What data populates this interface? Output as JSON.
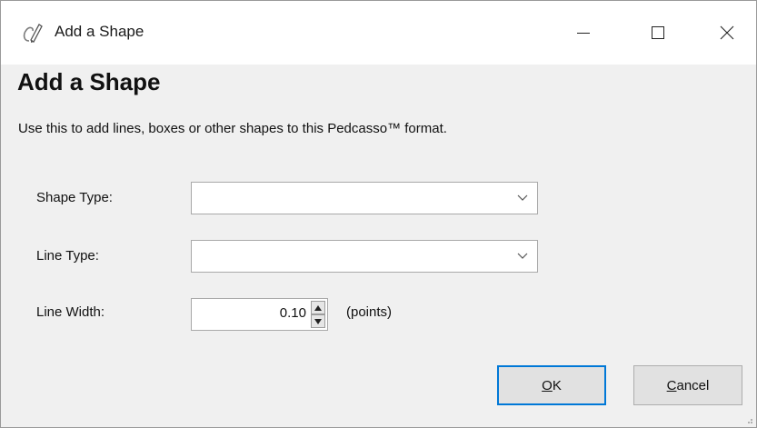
{
  "window": {
    "title": "Add a Shape",
    "icon": "pencil-app-icon",
    "controls": {
      "minimize": "minimize-icon",
      "maximize": "maximize-icon",
      "close": "close-icon"
    }
  },
  "dialog": {
    "heading": "Add a Shape",
    "description": "Use this to add lines, boxes or other shapes to this Pedcasso™ format."
  },
  "form": {
    "shape_type": {
      "label": "Shape Type:",
      "value": ""
    },
    "line_type": {
      "label": "Line Type:",
      "value": ""
    },
    "line_width": {
      "label": "Line Width:",
      "value": "0.10",
      "units": "(points)"
    }
  },
  "buttons": {
    "ok": {
      "mnemonic": "O",
      "rest": "K"
    },
    "cancel": {
      "mnemonic": "C",
      "rest": "ancel"
    }
  },
  "colors": {
    "focus_border": "#0078d7",
    "dialog_bg": "#f0f0f0"
  }
}
